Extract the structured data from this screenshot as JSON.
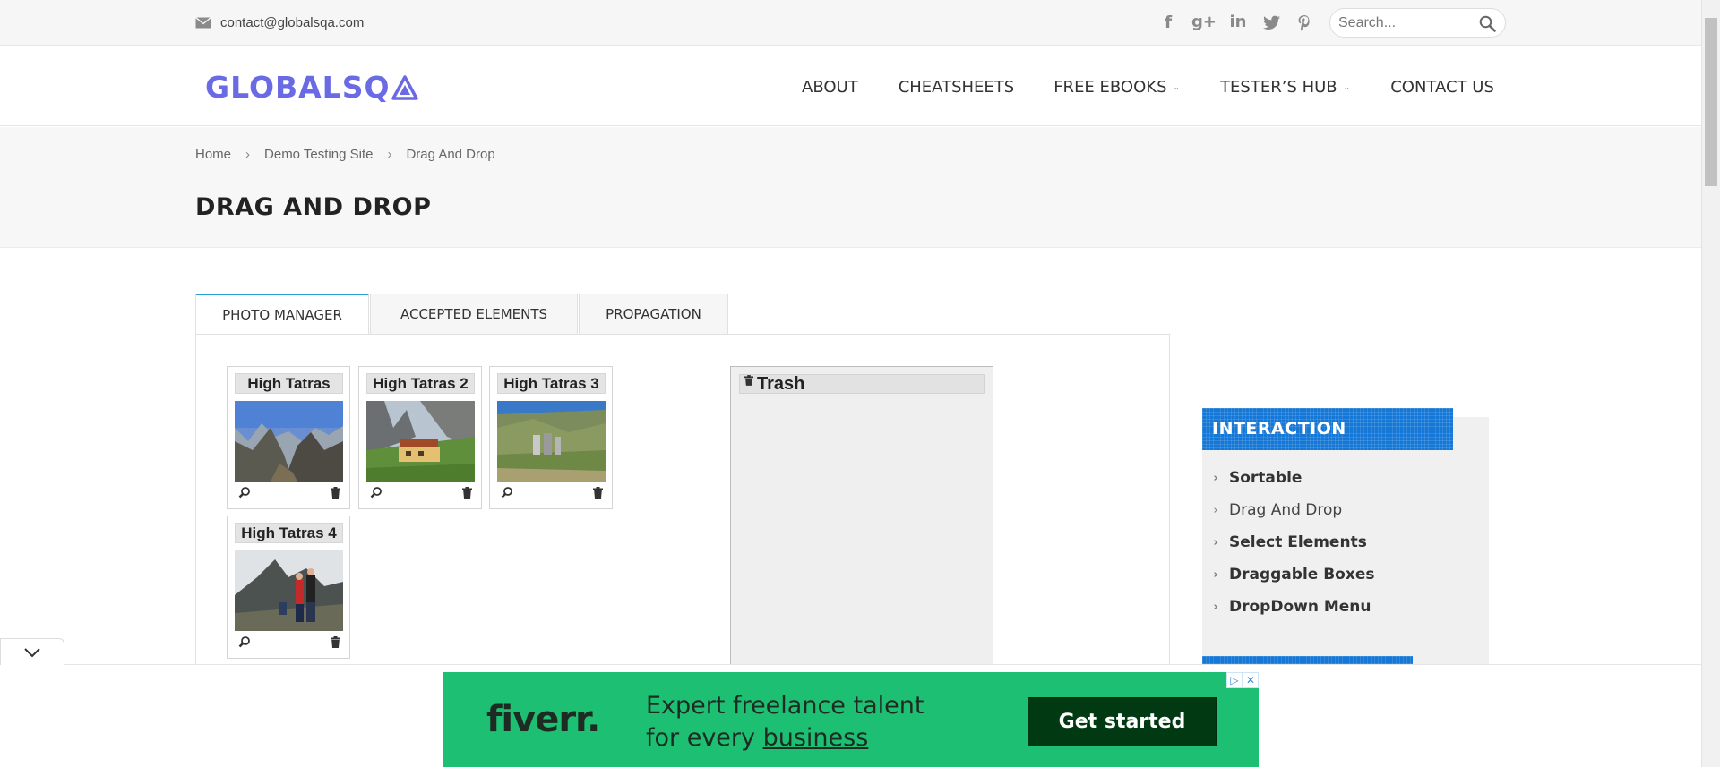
{
  "topbar": {
    "email": "contact@globalsqa.com",
    "social_icons": [
      "facebook-icon",
      "google-plus-icon",
      "linkedin-icon",
      "twitter-icon",
      "pinterest-icon"
    ],
    "search_placeholder": "Search..."
  },
  "header": {
    "logo_text": "GLOBALSQ",
    "nav": [
      {
        "label": "ABOUT",
        "dropdown": false
      },
      {
        "label": "CHEATSHEETS",
        "dropdown": false
      },
      {
        "label": "FREE EBOOKS",
        "dropdown": true
      },
      {
        "label": "TESTER’S HUB",
        "dropdown": true
      },
      {
        "label": "CONTACT US",
        "dropdown": false
      }
    ]
  },
  "breadcrumb": [
    "Home",
    "Demo Testing Site",
    "Drag And Drop"
  ],
  "page_title": "DRAG AND DROP",
  "tabs": [
    {
      "label": "PHOTO MANAGER",
      "active": true
    },
    {
      "label": "ACCEPTED ELEMENTS",
      "active": false
    },
    {
      "label": "PROPAGATION",
      "active": false
    }
  ],
  "gallery": [
    {
      "title": "High Tatras"
    },
    {
      "title": "High Tatras 2"
    },
    {
      "title": "High Tatras 3"
    },
    {
      "title": "High Tatras 4"
    }
  ],
  "trash": {
    "label": "Trash"
  },
  "sidebar": {
    "heading": "INTERACTION",
    "items": [
      {
        "label": "Sortable",
        "current": false
      },
      {
        "label": "Drag And Drop",
        "current": true
      },
      {
        "label": "Select Elements",
        "current": false
      },
      {
        "label": "Draggable Boxes",
        "current": false
      },
      {
        "label": "DropDown Menu",
        "current": false
      }
    ]
  },
  "ad": {
    "brand": "fiverr.",
    "tagline_line1": "Expert freelance talent",
    "tagline_line2_prefix": "for every ",
    "tagline_line2_link": "business",
    "cta": "Get started",
    "brand_color": "#1dbf73",
    "cta_color": "#003912"
  },
  "colors": {
    "logo": "#6a6ae5",
    "tab_accent": "#2a9fd8",
    "sidebar_heading": "#1577d6"
  }
}
